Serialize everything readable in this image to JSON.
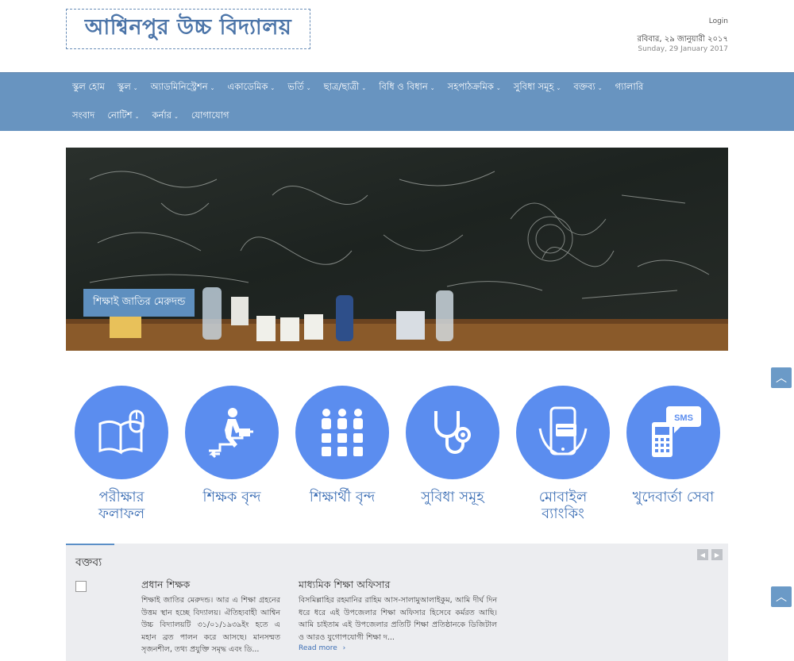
{
  "header": {
    "site_title": "আশ্বিনপুর উচ্চ বিদ্যালয়",
    "login_label": "Login",
    "date_bengali": "রবিবার, ২৯ জানুয়ারী ২০১৭",
    "date_english": "Sunday, 29 January 2017"
  },
  "nav": {
    "row1": [
      {
        "label": "স্কুল হোম",
        "dropdown": false
      },
      {
        "label": "স্কুল",
        "dropdown": true
      },
      {
        "label": "অ্যাডমিনিস্ট্রেশন",
        "dropdown": true
      },
      {
        "label": "একাডেমিক",
        "dropdown": true
      },
      {
        "label": "ভর্তি",
        "dropdown": true
      },
      {
        "label": "ছাত্র/ছাত্রী",
        "dropdown": true
      },
      {
        "label": "বিধি ও বিধান",
        "dropdown": true
      },
      {
        "label": "সহপাঠক্রমিক",
        "dropdown": true
      },
      {
        "label": "সুবিধা সমূহ",
        "dropdown": true
      },
      {
        "label": "বক্তব্য",
        "dropdown": true
      },
      {
        "label": "গ্যালারি",
        "dropdown": false
      }
    ],
    "row2": [
      {
        "label": "সংবাদ",
        "dropdown": false
      },
      {
        "label": "নোটিশ",
        "dropdown": true
      },
      {
        "label": "কর্নার",
        "dropdown": true
      },
      {
        "label": "যোগাযোগ",
        "dropdown": false
      }
    ],
    "chevron": "⌄"
  },
  "slider": {
    "caption": "শিক্ষাই জাতির মেরুদন্ড"
  },
  "scroll_top_icon": "︿",
  "tiles": [
    {
      "label": "পরীক্ষার ফলাফল",
      "icon": "book-mouse-icon"
    },
    {
      "label": "শিক্ষক বৃন্দ",
      "icon": "teacher-stairs-icon"
    },
    {
      "label": "শিক্ষার্থী বৃন্দ",
      "icon": "students-group-icon"
    },
    {
      "label": "সুবিধা সমূহ",
      "icon": "stethoscope-icon"
    },
    {
      "label": "মোবাইল ব্যাংকিং",
      "icon": "mobile-banking-icon"
    },
    {
      "label": "খুদেবার্তা সেবা",
      "icon": "sms-phone-icon"
    }
  ],
  "sms_badge": "SMS",
  "speech_panel": {
    "title": "বক্তব্য",
    "prev_icon": "◀",
    "next_icon": "▶",
    "items": [
      {
        "title": "প্রধান শিক্ষক",
        "text": "শিক্ষাই জাতির মেরুদন্ড। আর এ শিক্ষা গ্রহনের উত্তম স্থান হচ্ছে বিদ্যালয়। ঐতিহ্যবাহী আশ্বিন উচ্চ বিদ্যালয়টি ৩১/০১/১৯৩৯ইং হতে এ মহান ব্রত পালন করে আসছে। মানসম্মত সৃজনশীল, তথ্য প্রযুক্তি সমৃদ্ধ এবং ডি..."
      },
      {
        "title": "মাধ্যমিক শিক্ষা অফিসার",
        "text": "বিসমিল্লাহির রহমানির রাহিম আস-সালামুআলাইকুম, আমি দীর্ঘ দিন ধরে ধরে এই উপজেলার শিক্ষা অফিসার হিসেবে কর্মরত আছি। আমি চাইতাম এই উপজেলার প্রতিটি শিক্ষা প্রতিষ্ঠানকে ডিজিটাল ও আরও যুগোপযোগী শিক্ষা দ...",
        "read_more": "Read more"
      }
    ]
  }
}
